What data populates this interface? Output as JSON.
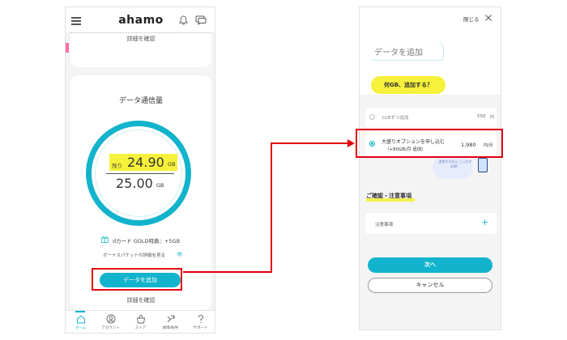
{
  "left": {
    "logo": "ahamo",
    "top_detail_link": "詳細を確認",
    "usage_title": "データ通信量",
    "remaining_label": "残り",
    "remaining_value": "24.90",
    "remaining_unit": "GB",
    "total_value": "25.00",
    "total_unit": "GB",
    "dcard_text": "dカード GOLD特典：+5GB",
    "bonus_link": "ボーナスパケットの詳細を見る",
    "add_data_button": "データを追加",
    "bottom_detail_link": "詳細を確認",
    "tabs": [
      {
        "label": "ホーム",
        "icon": "home-icon",
        "active": true
      },
      {
        "label": "アカウント",
        "icon": "account-icon",
        "active": false
      },
      {
        "label": "ストア",
        "icon": "store-icon",
        "active": false
      },
      {
        "label": "故障/紛失",
        "icon": "repair-icon",
        "active": false
      },
      {
        "label": "サポート",
        "icon": "support-icon",
        "active": false
      }
    ]
  },
  "right": {
    "close_label": "閉じる",
    "title": "データを追加",
    "question": "何GB、追加する？",
    "option1": {
      "label": "1GBずつ追加",
      "price": "550",
      "unit": "円"
    },
    "option2": {
      "label_line1": "大盛りオプションを申し込む",
      "label_line2": "（+80GB/月 追加）",
      "price": "1,980",
      "unit": "円/月",
      "selected": true
    },
    "promo_text": "追加するなら こっちがお得！",
    "notes_title": "ご確認・注意事項",
    "notes_item": "注意事項",
    "next_button": "次へ",
    "cancel_button": "キャンセル"
  },
  "colors": {
    "accent": "#12b3cc",
    "highlight": "#f6f13a",
    "annotation": "#e30012"
  }
}
